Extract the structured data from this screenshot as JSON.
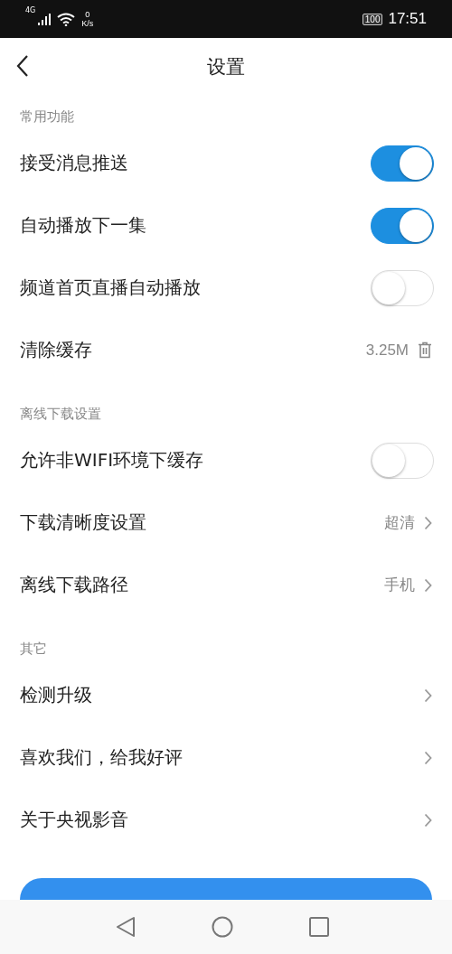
{
  "status_bar": {
    "network": "4G",
    "speed_value": "0",
    "speed_unit": "K/s",
    "battery": "100",
    "time": "17:51"
  },
  "header": {
    "title": "设置"
  },
  "sections": [
    {
      "title": "常用功能",
      "items": [
        {
          "kind": "toggle",
          "label": "接受消息推送",
          "on": true
        },
        {
          "kind": "toggle",
          "label": "自动播放下一集",
          "on": true
        },
        {
          "kind": "toggle",
          "label": "频道首页直播自动播放",
          "on": false
        },
        {
          "kind": "clear",
          "label": "清除缓存",
          "value": "3.25M"
        }
      ]
    },
    {
      "title": "离线下载设置",
      "items": [
        {
          "kind": "toggle",
          "label": "允许非WIFI环境下缓存",
          "on": false
        },
        {
          "kind": "link",
          "label": "下载清晰度设置",
          "value": "超清"
        },
        {
          "kind": "link",
          "label": "离线下载路径",
          "value": "手机"
        }
      ]
    },
    {
      "title": "其它",
      "items": [
        {
          "kind": "link",
          "label": "检测升级"
        },
        {
          "kind": "link",
          "label": "喜欢我们，给我好评"
        },
        {
          "kind": "link",
          "label": "关于央视影音"
        }
      ]
    }
  ],
  "bottom_button": {
    "kind": "partly_hidden"
  }
}
